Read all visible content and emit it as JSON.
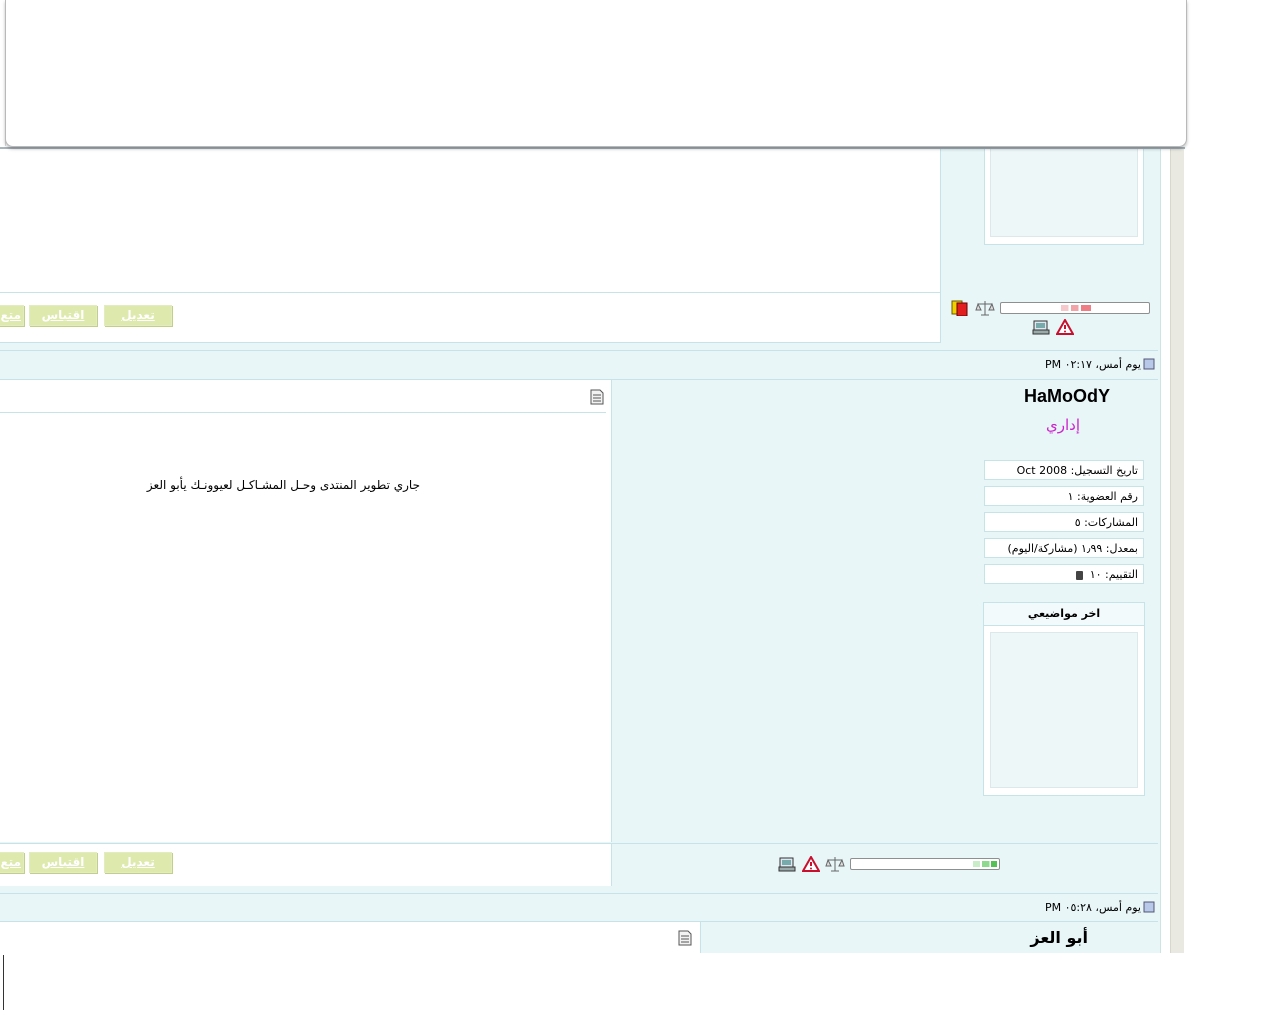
{
  "posts": [
    {
      "id": "prev",
      "buttons": {
        "edit": "تعديل",
        "quote": "اقتباس",
        "more": "متع"
      }
    },
    {
      "id": "post-hamoody",
      "date": "يوم أمس، ٠٢:١٧ PM",
      "username": "HaMoOdY",
      "usertitle": "إداري",
      "info": [
        "تاريخ التسجيل: Oct 2008",
        "رقم العضوية: ١",
        "المشاركات: ٥",
        "بمعدل: ١٫٩٩ (مشاركة/اليوم)",
        "التقييم: ١٠"
      ],
      "latest_topics_title": "اخر مواضيعي",
      "message": "جاري تطوير المنتدى وحـل المشـاكـل لعيوونـك يأبو العز",
      "reputation": 0.15,
      "buttons": {
        "edit": "تعديل",
        "quote": "اقتباس",
        "more": "متع"
      }
    },
    {
      "id": "post-abualez",
      "date": "يوم أمس، ٠٥:٢٨ PM",
      "username": "أبو العز"
    }
  ],
  "colors": {
    "page_bg": "#e8f6f8",
    "border": "#c6e3e8",
    "button_bg": "#dee9ad",
    "usertitle": "#cc22cc",
    "rep_red": "#f07c84",
    "rep_green": "#55c155"
  },
  "icons": [
    "post-icon",
    "document-icon",
    "report-icon",
    "warning-icon",
    "scales-icon",
    "card-icon"
  ]
}
